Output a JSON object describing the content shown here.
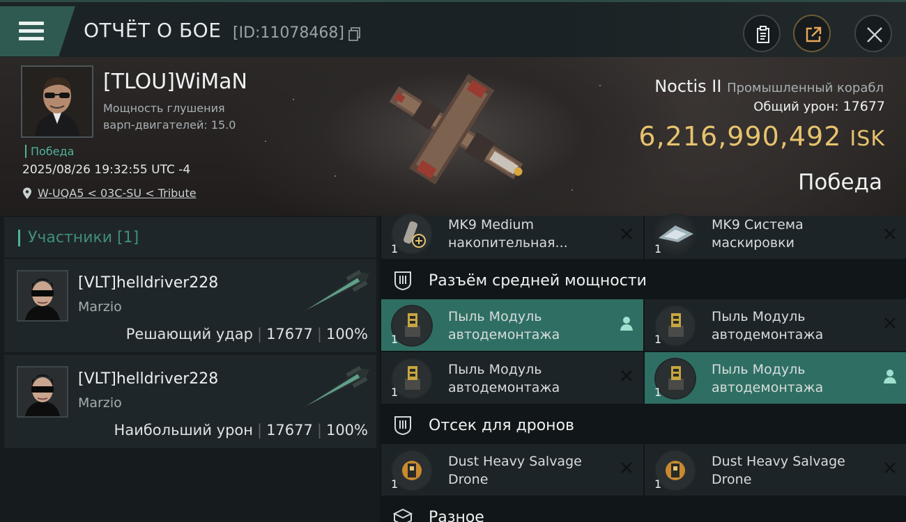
{
  "header": {
    "title": "ОТЧЁТ О БОЕ",
    "report_id": "[ID:11078468]"
  },
  "victim": {
    "name": "[TLOU]WiMaN",
    "attribute_label": "Мощность глушения",
    "attribute_line2": "варп-двигателей: 15.0",
    "status_tag": "Победа",
    "timestamp": "2025/08/26 19:32:55 UTC -4",
    "location": "W-UQA5 < 03C-SU < Tribute"
  },
  "ship": {
    "name": "Noctis II",
    "class": "Промышленный корабл",
    "total_damage_label": "Общий урон:",
    "total_damage": "17677",
    "isk_value": "6,216,990,492",
    "isk_unit": "ISK",
    "result": "Победа"
  },
  "participants": {
    "label": "Участники [1]",
    "items": [
      {
        "name": "[VLT]helldriver228",
        "ship": "Marzio",
        "role": "Решающий удар",
        "damage": "17677",
        "percent": "100%"
      },
      {
        "name": "[VLT]helldriver228",
        "ship": "Marzio",
        "role": "Наибольший урон",
        "damage": "17677",
        "percent": "100%"
      }
    ]
  },
  "fittings": {
    "top_row": [
      {
        "qty": "1",
        "line1": "MK9 Medium",
        "line2": "накопительная..."
      },
      {
        "qty": "1",
        "line1": "MK9 Система",
        "line2": "маскировки"
      }
    ],
    "mid_section": "Разъём средней мощности",
    "mid_slots": [
      {
        "qty": "1",
        "line1": "Пыль Модуль",
        "line2": "автодемонтажа"
      },
      {
        "qty": "1",
        "line1": "Пыль Модуль",
        "line2": "автодемонтажа"
      },
      {
        "qty": "1",
        "line1": "Пыль Модуль",
        "line2": "автодемонтажа"
      },
      {
        "qty": "1",
        "line1": "Пыль Модуль",
        "line2": "автодемонтажа"
      }
    ],
    "drone_section": "Отсек для дронов",
    "drones": [
      {
        "qty": "1",
        "line1": "Dust Heavy Salvage",
        "line2": "Drone"
      },
      {
        "qty": "1",
        "line1": "Dust Heavy Salvage",
        "line2": "Drone"
      }
    ],
    "misc_section": "Разное"
  },
  "colors": {
    "accent_teal": "#4fb49a",
    "active_slot": "#2f6f63",
    "isk_gold": "#e7c36e"
  }
}
